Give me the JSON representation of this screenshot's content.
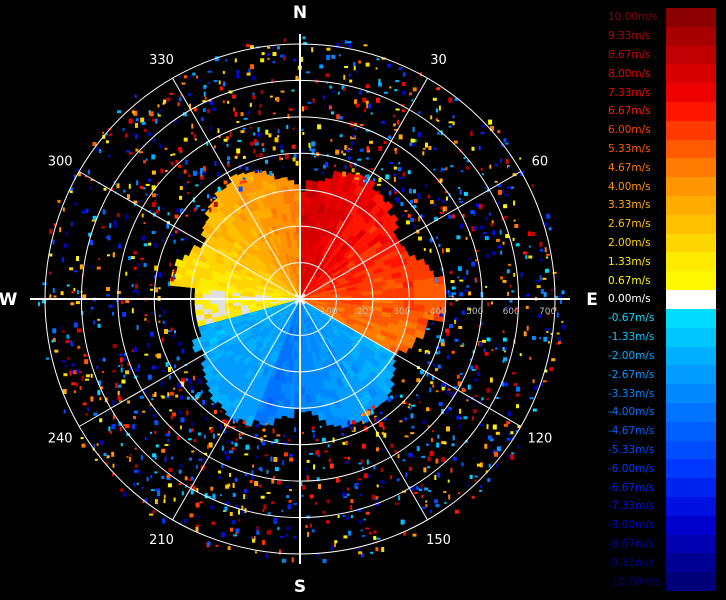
{
  "chart_data": {
    "type": "polar-radar-velocity",
    "cardinals": {
      "north": "N",
      "south": "S",
      "east": "E",
      "west": "W"
    },
    "azimuth_labels": [
      "30",
      "60",
      "120",
      "150",
      "210",
      "240",
      "300",
      "330"
    ],
    "azimuth_values": [
      30,
      60,
      120,
      150,
      210,
      240,
      300,
      330
    ],
    "range_labels": [
      "100",
      "200",
      "300",
      "400",
      "500",
      "600",
      "700"
    ],
    "range_values": [
      100,
      200,
      300,
      400,
      500,
      600,
      700
    ],
    "range_max": 700,
    "echo_range": 370,
    "colorbar": {
      "labels": [
        "10.00m/s",
        "9.33m/s",
        "8.67m/s",
        "8.00m/s",
        "7.33m/s",
        "6.67m/s",
        "6.00m/s",
        "5.33m/s",
        "4.67m/s",
        "4.00m/s",
        "3.33m/s",
        "2.67m/s",
        "2.00m/s",
        "1.33m/s",
        "0.67m/s",
        "0.00m/s",
        "-0.67m/s",
        "-1.33m/s",
        "-2.00m/s",
        "-2.67m/s",
        "-3.33m/s",
        "-4.00m/s",
        "-4.67m/s",
        "-5.33m/s",
        "-6.00m/s",
        "-6.67m/s",
        "-7.33m/s",
        "-8.00m/s",
        "-8.67m/s",
        "-9.33m/s",
        "-10.00m/s"
      ],
      "colors": [
        "#8b0000",
        "#a80000",
        "#c00000",
        "#d80000",
        "#ee0000",
        "#ff1500",
        "#ff3a00",
        "#ff5a00",
        "#ff7a00",
        "#ff9500",
        "#ffab00",
        "#ffc000",
        "#ffd600",
        "#ffeb00",
        "#fff700",
        "#ffffff",
        "#00dcff",
        "#00c6ff",
        "#00b0ff",
        "#009cff",
        "#0088ff",
        "#0074ff",
        "#0060ff",
        "#004cff",
        "#0038ff",
        "#0024f0",
        "#0010e0",
        "#0000cc",
        "#0000b0",
        "#000094",
        "#000078"
      ],
      "label_colors": [
        "#8b0000",
        "#b00000",
        "#c80000",
        "#e00000",
        "#ee0000",
        "#ff2000",
        "#ff4000",
        "#ff5a00",
        "#ff7a00",
        "#ff9500",
        "#ffab00",
        "#ffc000",
        "#ffd600",
        "#ffeb00",
        "#fff700",
        "#ffffff",
        "#00dcff",
        "#00c6ff",
        "#00b0ff",
        "#009cff",
        "#0088ff",
        "#0074ff",
        "#0060ff",
        "#004cff",
        "#0038ff",
        "#0024f0",
        "#0010e0",
        "#0000cc",
        "#0000b0",
        "#000094",
        "#000078"
      ]
    }
  }
}
